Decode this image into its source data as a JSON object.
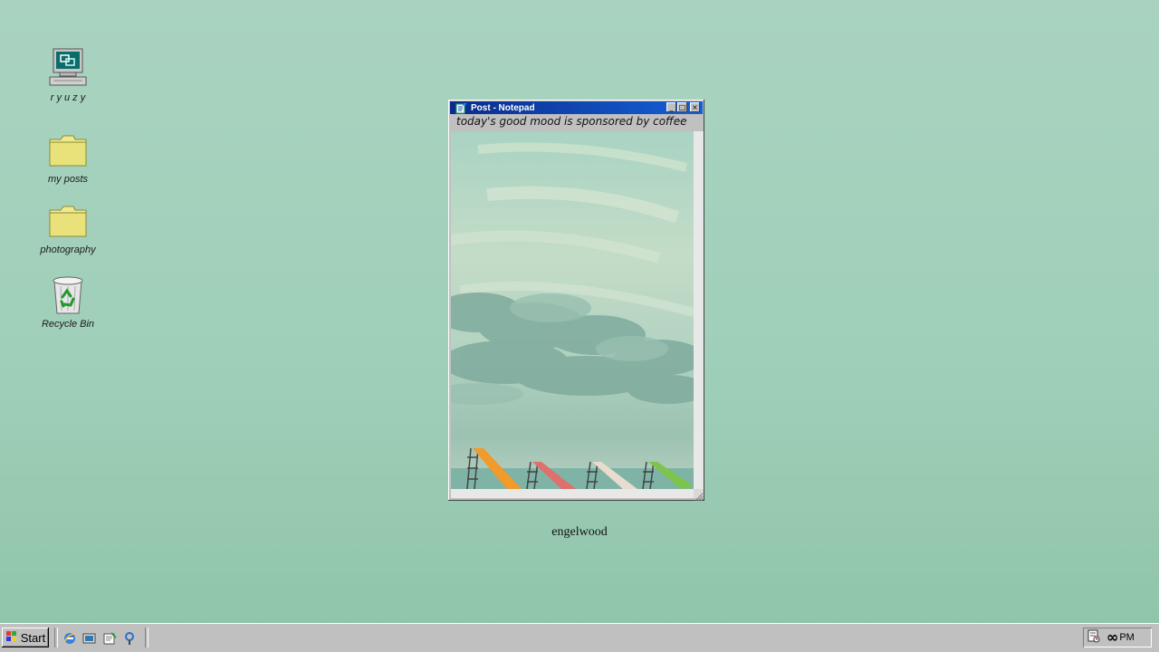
{
  "desktop": {
    "icons": [
      {
        "label": "r y u z y",
        "icon": "computer-icon"
      },
      {
        "label": "my posts",
        "icon": "folder-icon"
      },
      {
        "label": "photography",
        "icon": "folder-icon"
      },
      {
        "label": "Recycle Bin",
        "icon": "recycle-bin-icon"
      }
    ]
  },
  "window": {
    "title": "Post - Notepad",
    "caption": "today's good mood is sponsored by coffee",
    "buttons": {
      "minimize": "_",
      "maximize": "□",
      "close": "×"
    }
  },
  "photo_caption": "engelwood",
  "taskbar": {
    "start_label": "Start",
    "quick_launch": [
      "ie-icon",
      "desktop-icon",
      "outlook-icon",
      "channels-icon"
    ],
    "clock_symbol": "∞",
    "clock_suffix": "PM"
  },
  "colors": {
    "desktop": "#a4d2bd",
    "titlebar": "#0a2c8c",
    "chrome": "#c0c0c0"
  }
}
